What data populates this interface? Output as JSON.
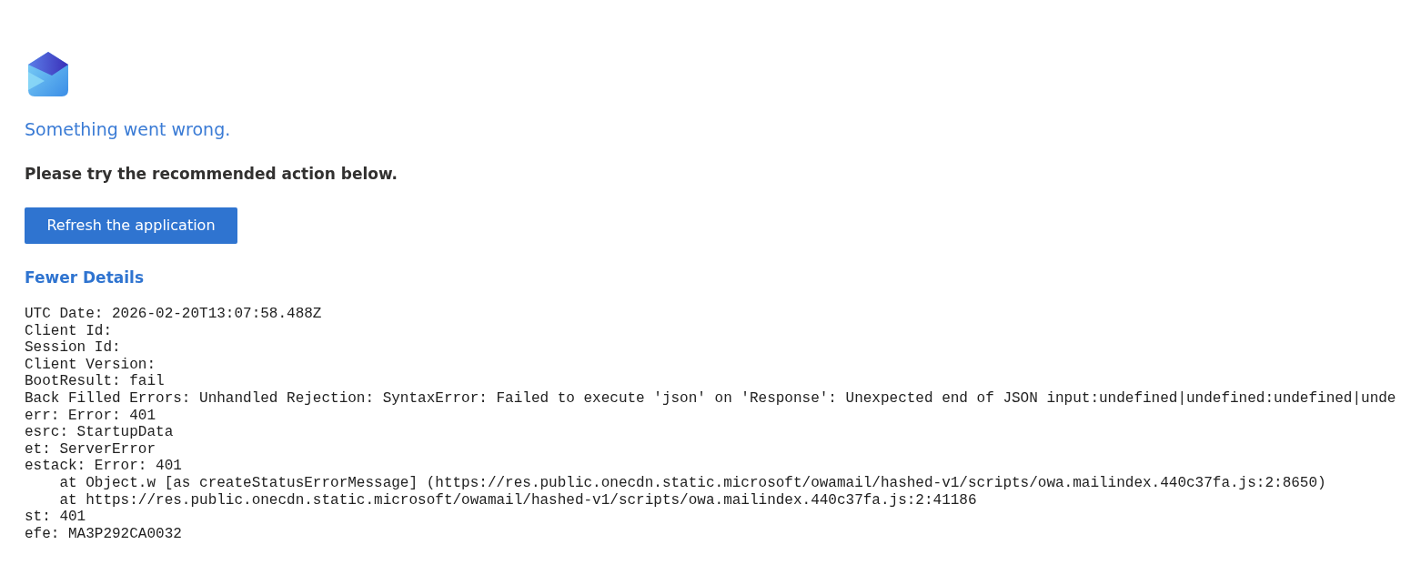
{
  "heading": "Something went wrong.",
  "instruction": "Please try the recommended action below.",
  "refresh_button": {
    "label": "Refresh the application"
  },
  "details_toggle": {
    "label": "Fewer Details"
  },
  "details": [
    "UTC Date: 2026-02-20T13:07:58.488Z",
    "Client Id:",
    "Session Id:",
    "Client Version:",
    "BootResult: fail",
    "Back Filled Errors: Unhandled Rejection: SyntaxError: Failed to execute 'json' on 'Response': Unexpected end of JSON input:undefined|undefined:undefined|unde",
    "err: Error: 401",
    "esrc: StartupData",
    "et: ServerError",
    "estack: Error: 401",
    "    at Object.w [as createStatusErrorMessage] (https://res.public.onecdn.static.microsoft/owamail/hashed-v1/scripts/owa.mailindex.440c37fa.js:2:8650)",
    "    at https://res.public.onecdn.static.microsoft/owamail/hashed-v1/scripts/owa.mailindex.440c37fa.js:2:41186",
    "st: 401",
    "efe: MA3P292CA0032"
  ]
}
